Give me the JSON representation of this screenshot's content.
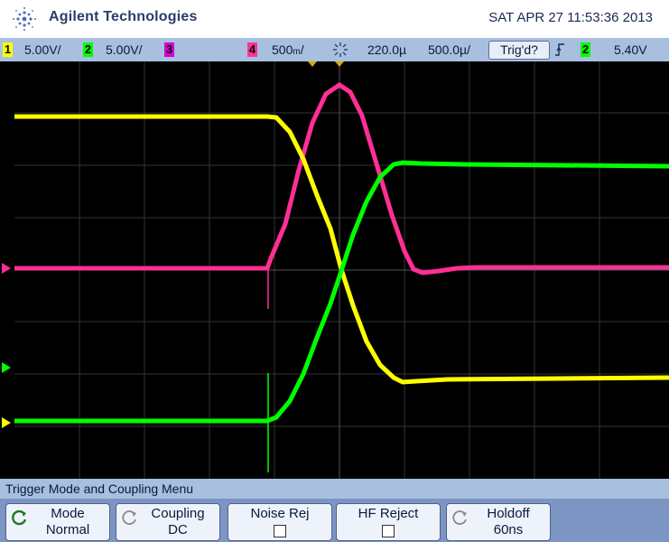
{
  "header": {
    "brand": "Agilent Technologies",
    "datetime": "SAT APR 27 11:53:36 2013"
  },
  "status": {
    "ch1_num": "1",
    "ch1_scale": "5.00V/",
    "ch2_num": "2",
    "ch2_scale": "5.00V/",
    "ch3_num": "3",
    "ch4_num": "4",
    "ch4_scale": "500&#x2F;",
    "delay": "220.0µ",
    "timebase": "500.0µ/",
    "trig_button": "Trig'd?",
    "trig_src_num": "2",
    "trig_level": "5.40V"
  },
  "menu": {
    "title": "Trigger Mode and Coupling Menu",
    "mode_label": "Mode",
    "mode_value": "Normal",
    "coupling_label": "Coupling",
    "coupling_value": "DC",
    "noise_label": "Noise Rej",
    "hf_label": "HF Reject",
    "holdoff_label": "Holdoff",
    "holdoff_value": "60ns"
  },
  "colors": {
    "ch1": "#ffff00",
    "ch2": "#00ff00",
    "ch3": "#ff00aa",
    "ch4": "#ff3399",
    "bar": "#a8bfe0"
  }
}
